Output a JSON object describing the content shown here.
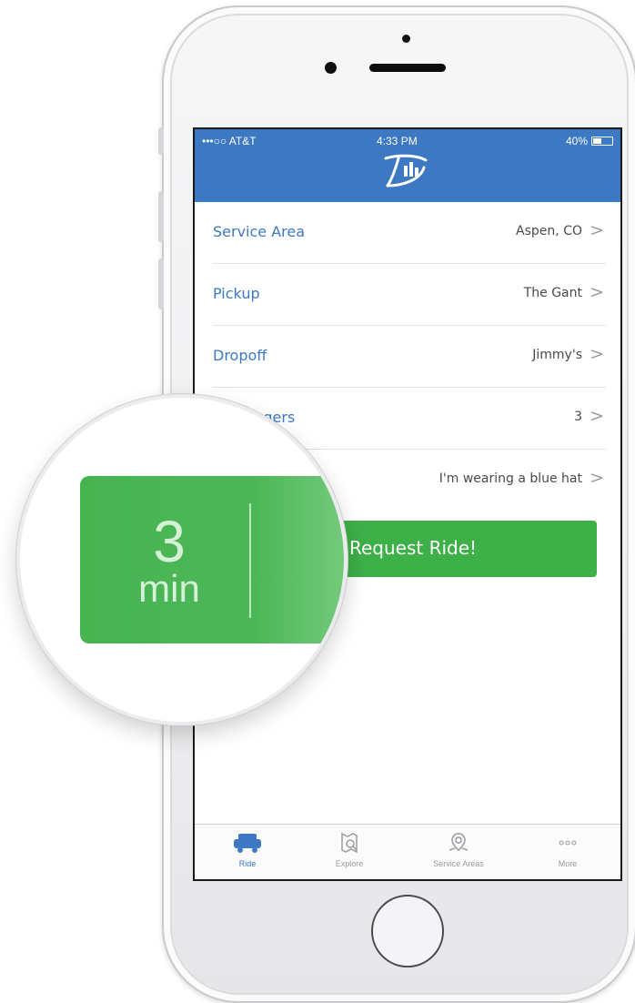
{
  "status": {
    "carrier": "•••○○ AT&T",
    "time": "4:33 PM",
    "battery": "40%"
  },
  "rows": [
    {
      "label": "Service Area",
      "value": "Aspen, CO"
    },
    {
      "label": "Pickup",
      "value": "The Gant"
    },
    {
      "label": "Dropoff",
      "value": "Jimmy's"
    },
    {
      "label": "Passengers",
      "value": "3"
    },
    {
      "label": "",
      "value": "I'm wearing a blue hat"
    }
  ],
  "request_button": {
    "label": "Request Ride!"
  },
  "tabs": [
    {
      "label": "Ride",
      "icon": "car-icon",
      "active": true
    },
    {
      "label": "Explore",
      "icon": "map-search-icon"
    },
    {
      "label": "Service Areas",
      "icon": "map-pin-icon"
    },
    {
      "label": "More",
      "icon": "more-dots-icon"
    }
  ],
  "magnifier": {
    "number": "3",
    "unit": "min"
  },
  "colors": {
    "brand_blue": "#3c79c2",
    "green": "#3db048"
  }
}
